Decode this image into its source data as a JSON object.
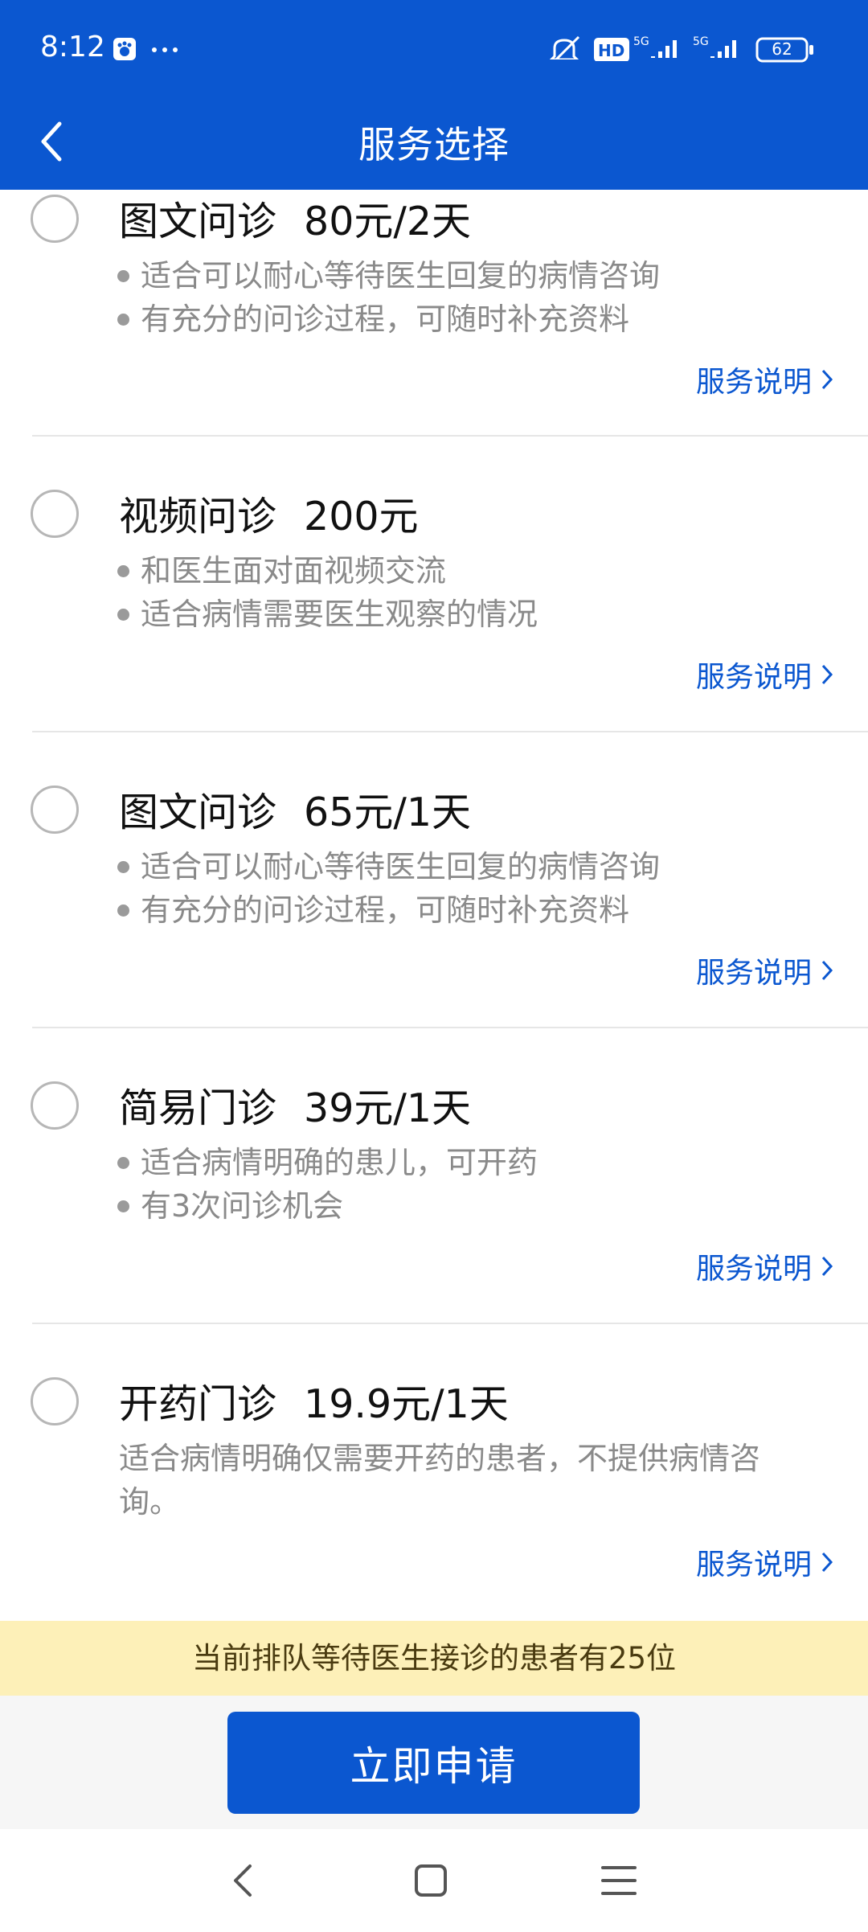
{
  "status_bar": {
    "time": "8:12",
    "icons": [
      "baidu-app-icon",
      "more-dots-icon",
      "mute-icon",
      "hd-icon",
      "signal-5g-icon",
      "signal-5g-icon",
      "battery-icon"
    ],
    "battery": "62"
  },
  "header": {
    "title": "服务选择",
    "back_icon": "chevron-left-icon"
  },
  "services": [
    {
      "name": "图文问诊",
      "price": "80元/2天",
      "bullets": [
        "适合可以耐心等待医生回复的病情咨询",
        "有充分的问诊过程，可随时补充资料"
      ],
      "link": "服务说明"
    },
    {
      "name": "视频问诊",
      "price": "200元",
      "bullets": [
        "和医生面对面视频交流",
        "适合病情需要医生观察的情况"
      ],
      "link": "服务说明"
    },
    {
      "name": "图文问诊",
      "price": "65元/1天",
      "bullets": [
        "适合可以耐心等待医生回复的病情咨询",
        "有充分的问诊过程，可随时补充资料"
      ],
      "link": "服务说明"
    },
    {
      "name": "简易门诊",
      "price": "39元/1天",
      "bullets": [
        "适合病情明确的患儿，可开药",
        "有3次问诊机会"
      ],
      "link": "服务说明"
    },
    {
      "name": "开药门诊",
      "price": "19.9元/1天",
      "description": "适合病情明确仅需要开药的患者，不提供病情咨询。",
      "link": "服务说明"
    }
  ],
  "notice": "当前排队等待医生接诊的患者有25位",
  "apply_button": "立即申请",
  "colors": {
    "primary": "#0b57d0",
    "notice_bg": "#fdf0b8",
    "muted_text": "#8a8a8a"
  },
  "nav_bar": {
    "icons": [
      "back-triangle-icon",
      "home-square-icon",
      "menu-lines-icon"
    ]
  }
}
